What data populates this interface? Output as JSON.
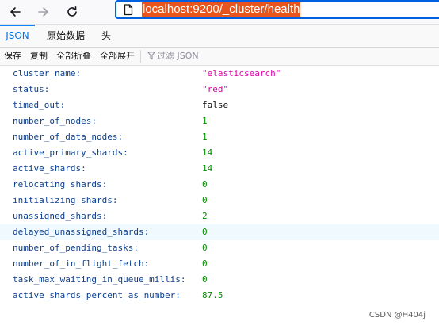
{
  "browser": {
    "url": "localhost:9200/_cluster/health"
  },
  "tabs": [
    {
      "label": "JSON",
      "active": true
    },
    {
      "label": "原始数据",
      "active": false
    },
    {
      "label": "头",
      "active": false
    }
  ],
  "json_toolbar": {
    "save": "保存",
    "copy": "复制",
    "collapse_all": "全部折叠",
    "expand_all": "全部展开",
    "filter_placeholder": "过滤 JSON"
  },
  "rows": [
    {
      "key": "cluster_name:",
      "value": "\"elasticsearch\"",
      "type": "string"
    },
    {
      "key": "status:",
      "value": "\"red\"",
      "type": "string"
    },
    {
      "key": "timed_out:",
      "value": "false",
      "type": "bool"
    },
    {
      "key": "number_of_nodes:",
      "value": "1",
      "type": "number"
    },
    {
      "key": "number_of_data_nodes:",
      "value": "1",
      "type": "number"
    },
    {
      "key": "active_primary_shards:",
      "value": "14",
      "type": "number"
    },
    {
      "key": "active_shards:",
      "value": "14",
      "type": "number"
    },
    {
      "key": "relocating_shards:",
      "value": "0",
      "type": "number"
    },
    {
      "key": "initializing_shards:",
      "value": "0",
      "type": "number"
    },
    {
      "key": "unassigned_shards:",
      "value": "2",
      "type": "number"
    },
    {
      "key": "delayed_unassigned_shards:",
      "value": "0",
      "type": "number",
      "highlighted": true
    },
    {
      "key": "number_of_pending_tasks:",
      "value": "0",
      "type": "number"
    },
    {
      "key": "number_of_in_flight_fetch:",
      "value": "0",
      "type": "number"
    },
    {
      "key": "task_max_waiting_in_queue_millis:",
      "value": "0",
      "type": "number"
    },
    {
      "key": "active_shards_percent_as_number:",
      "value": "87.5",
      "type": "number"
    }
  ],
  "watermark": "CSDN @H404j",
  "icons": {
    "back": "back-arrow-icon",
    "forward": "forward-arrow-icon",
    "reload": "reload-icon",
    "page": "page-icon",
    "filter": "filter-icon"
  },
  "colors": {
    "key": "#0b3f8f",
    "string": "#dd00a9",
    "number": "#058b00",
    "url_highlight": "#e8541c",
    "active_tab": "#0074e8",
    "focus_border": "#0060df"
  }
}
